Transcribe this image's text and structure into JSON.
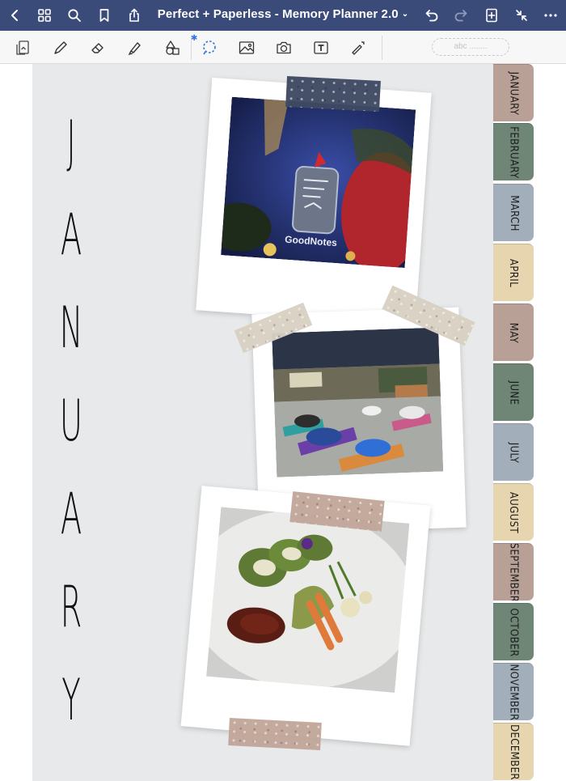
{
  "app": {
    "title": "Perfect + Paperless - Memory Planner 2.0",
    "title_chevron": "⌄"
  },
  "toolbar": {
    "text_field_placeholder": "abc ........",
    "bluetooth_mark": "✱"
  },
  "page": {
    "month_letters": [
      "J",
      "A",
      "N",
      "U",
      "A",
      "R",
      "Y"
    ],
    "photo_logo_text": "GoodNotes"
  },
  "tabs": [
    {
      "label": "JANUARY",
      "color": "#b9a096"
    },
    {
      "label": "FEBRUARY",
      "color": "#6f8576"
    },
    {
      "label": "MARCH",
      "color": "#a2afbb"
    },
    {
      "label": "APRIL",
      "color": "#e6d5ae"
    },
    {
      "label": "MAY",
      "color": "#b9a096"
    },
    {
      "label": "JUNE",
      "color": "#6f8576"
    },
    {
      "label": "JULY",
      "color": "#a2afbb"
    },
    {
      "label": "AUGUST",
      "color": "#e6d5ae"
    },
    {
      "label": "SEPTEMBER",
      "color": "#b9a096"
    },
    {
      "label": "OCTOBER",
      "color": "#6f8576"
    },
    {
      "label": "NOVEMBER",
      "color": "#a2afbb"
    },
    {
      "label": "DECEMBER",
      "color": "#e6d5ae"
    }
  ],
  "colors": {
    "nav_bar": "#3a4b7a",
    "page_background": "#e7e9ea",
    "accent_blue": "#2e74e6"
  }
}
